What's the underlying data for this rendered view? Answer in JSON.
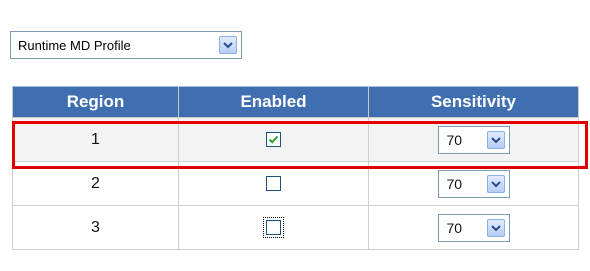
{
  "profile_select": {
    "value": "Runtime MD Profile"
  },
  "table": {
    "headers": {
      "region": "Region",
      "enabled": "Enabled",
      "sensitivity": "Sensitivity"
    },
    "rows": [
      {
        "region": "1",
        "enabled": true,
        "sensitivity": "70",
        "highlighted": true
      },
      {
        "region": "2",
        "enabled": false,
        "sensitivity": "70",
        "highlighted": false
      },
      {
        "region": "3",
        "enabled": false,
        "sensitivity": "70",
        "highlighted": false,
        "focused": true
      }
    ]
  },
  "colors": {
    "header_bg": "#3f6fb1",
    "highlight": "#e00000",
    "check": "#2fa02f"
  },
  "icons": {
    "dropdown": "chevron-down-icon",
    "check": "checkmark-icon"
  }
}
